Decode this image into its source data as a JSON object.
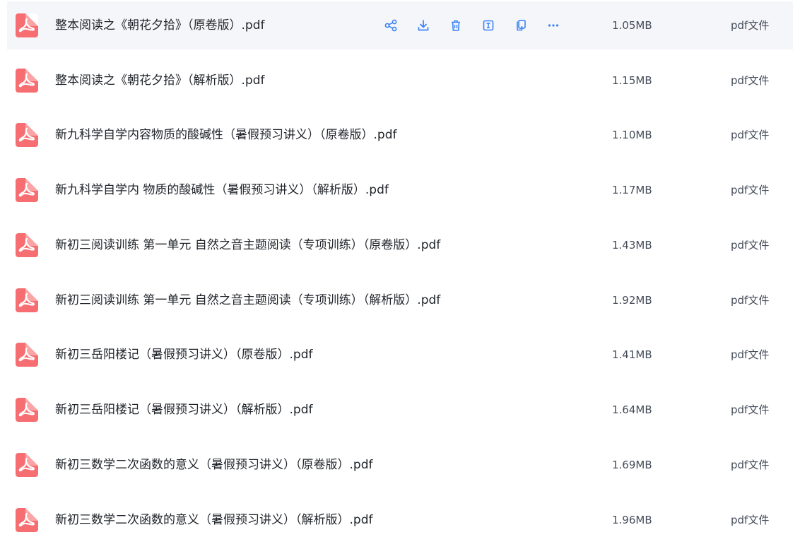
{
  "colors": {
    "accent": "#3b82f6",
    "pdf_icon": "#f76e72",
    "row_hover": "#f5f6fa",
    "text_primary": "#1f2329",
    "text_secondary": "#454d5a"
  },
  "row_actions": [
    {
      "name": "share-icon"
    },
    {
      "name": "download-icon"
    },
    {
      "name": "delete-icon"
    },
    {
      "name": "rename-icon"
    },
    {
      "name": "copy-icon"
    },
    {
      "name": "more-icon"
    }
  ],
  "files": [
    {
      "name": "整本阅读之《朝花夕拾》（原卷版）.pdf",
      "size": "1.05MB",
      "type": "pdf文件",
      "icon": "pdf-icon"
    },
    {
      "name": "整本阅读之《朝花夕拾》（解析版）.pdf",
      "size": "1.15MB",
      "type": "pdf文件",
      "icon": "pdf-icon"
    },
    {
      "name": "新九科学自学内容物质的酸碱性（暑假预习讲义）（原卷版）.pdf",
      "size": "1.10MB",
      "type": "pdf文件",
      "icon": "pdf-icon"
    },
    {
      "name": "新九科学自学内 物质的酸碱性（暑假预习讲义）（解析版）.pdf",
      "size": "1.17MB",
      "type": "pdf文件",
      "icon": "pdf-icon"
    },
    {
      "name": "新初三阅读训练 第一单元 自然之音主题阅读（专项训练）（原卷版）.pdf",
      "size": "1.43MB",
      "type": "pdf文件",
      "icon": "pdf-icon"
    },
    {
      "name": "新初三阅读训练 第一单元 自然之音主题阅读（专项训练）（解析版）.pdf",
      "size": "1.92MB",
      "type": "pdf文件",
      "icon": "pdf-icon"
    },
    {
      "name": "新初三岳阳楼记（暑假预习讲义）（原卷版）.pdf",
      "size": "1.41MB",
      "type": "pdf文件",
      "icon": "pdf-icon"
    },
    {
      "name": "新初三岳阳楼记（暑假预习讲义）（解析版）.pdf",
      "size": "1.64MB",
      "type": "pdf文件",
      "icon": "pdf-icon"
    },
    {
      "name": "新初三数学二次函数的意义（暑假预习讲义）（原卷版）.pdf",
      "size": "1.69MB",
      "type": "pdf文件",
      "icon": "pdf-icon"
    },
    {
      "name": "新初三数学二次函数的意义（暑假预习讲义）（解析版）.pdf",
      "size": "1.96MB",
      "type": "pdf文件",
      "icon": "pdf-icon"
    }
  ]
}
